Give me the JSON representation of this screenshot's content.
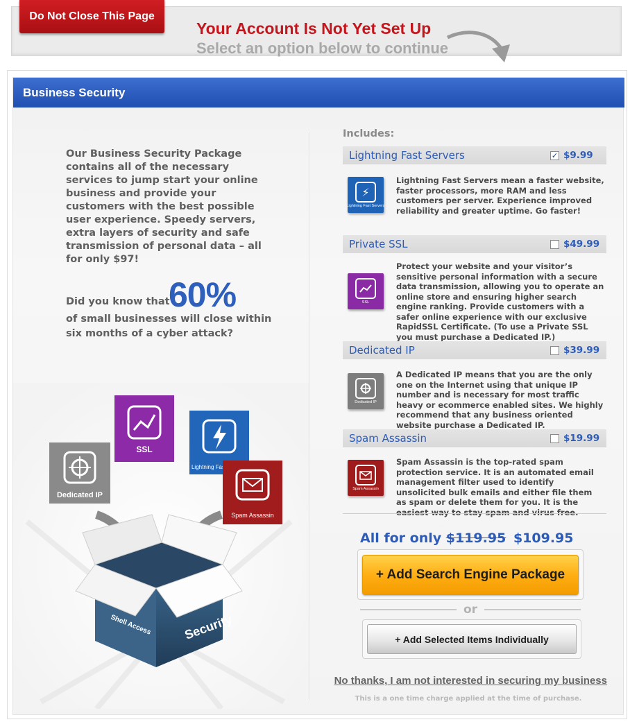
{
  "banner": {
    "tab_label": "Do Not Close This Page",
    "title": "Your Account Is Not Yet Set Up",
    "subtitle": "Select an option below to continue"
  },
  "panel": {
    "header": "Business Security",
    "intro": "Our Business Security Package contains all of the necessary services to jump start your online business and provide your customers with the best possible user experience. Speedy servers, extra layers of security and safe transmission of personal data – all for only $97!",
    "stat_pre": "Did you know that",
    "stat_num": "60%",
    "stat_post": "of small businesses will close within six months of a cyber attack?",
    "illustration_labels": {
      "dedicated": "Dedicated IP",
      "ssl": "SSL",
      "lightning": "Lightning Fast Servers",
      "spam": "Spam Assassin",
      "box_front": "Security",
      "box_side": "Shell Access",
      "box_ssl": "SSL"
    }
  },
  "includes_label": "Includes:",
  "items": [
    {
      "name": "Lightning Fast Servers",
      "price": "$9.99",
      "checked": "✓",
      "icon": "lightning-icon",
      "icon_caption": "Lightning Fast Servers",
      "color": "#1f63b6",
      "description": "Lightning Fast Servers mean a faster website, faster processors, more RAM and less customers per server.  Experience improved reliability and greater uptime. Go faster!"
    },
    {
      "name": "Private SSL",
      "price": "$49.99",
      "checked": "",
      "icon": "ssl-chart-icon",
      "icon_caption": "SSL",
      "color": "#8a2aa5",
      "description": "Protect your website and your visitor’s sensitive personal information with a secure data transmission, allowing you to operate an online store and ensuring higher search engine ranking. Provide customers with a safer online experience with our exclusive RapidSSL Certificate. (To use a Private SSL you must purchase a Dedicated IP.)"
    },
    {
      "name": "Dedicated IP",
      "price": "$39.99",
      "checked": "",
      "icon": "target-icon",
      "icon_caption": "Dedicated IP",
      "color": "#7d7d7d",
      "description": "A Dedicated IP means that you are the only one on the Internet using that unique IP number and is necessary for most traffic heavy or ecommerce enabled sites. We highly recommend that any business oriented website purchase a Dedicated IP."
    },
    {
      "name": "Spam Assassin",
      "price": "$19.99",
      "checked": "",
      "icon": "envelope-icon",
      "icon_caption": "Spam Assassin",
      "color": "#a01c1c",
      "description": "Spam Assassin is the top-rated spam protection service. It is an automated email management filter used to identify unsolicited bulk emails and either file them as spam or delete them for you. It is the easiest way to stay spam and virus free."
    }
  ],
  "pricing": {
    "prefix": "All for only",
    "old_price": "$119.95",
    "new_price": "$109.95"
  },
  "buttons": {
    "add_package": "+ Add Search Engine Package",
    "or": "or",
    "add_individual": "+ Add Selected Items Individually",
    "no_thanks": "No thanks, I am not interested in securing my business"
  },
  "fine_print": "This is a one time charge applied at the time of purchase."
}
